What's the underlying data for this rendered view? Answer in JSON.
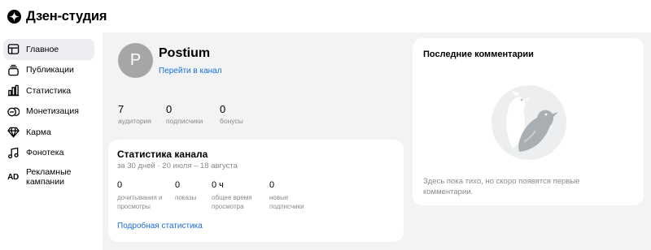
{
  "app": {
    "title": "Дзен-студия",
    "logo_icon": "zen-star-icon"
  },
  "sidebar": {
    "items": [
      {
        "label": "Главное",
        "icon": "layout-icon",
        "active": true
      },
      {
        "label": "Публикации",
        "icon": "publications-icon",
        "active": false
      },
      {
        "label": "Статистика",
        "icon": "bar-chart-icon",
        "active": false
      },
      {
        "label": "Монетизация",
        "icon": "coins-icon",
        "active": false
      },
      {
        "label": "Карма",
        "icon": "diamond-icon",
        "active": false
      },
      {
        "label": "Фонотека",
        "icon": "music-note-icon",
        "active": false
      },
      {
        "label": "Рекламные кампании",
        "icon": "ad-icon",
        "glyph": "AD",
        "active": false
      }
    ]
  },
  "channel": {
    "avatar_letter": "P",
    "name": "Postium",
    "link": "Перейти в канал",
    "stats": [
      {
        "value": "7",
        "caption": "аудитория"
      },
      {
        "value": "0",
        "caption": "подписчики"
      },
      {
        "value": "0",
        "caption": "бонусы"
      }
    ]
  },
  "channel_stats": {
    "title": "Статистика канала",
    "period": "за 30 дней · 20 июля – 18 августа",
    "metrics": [
      {
        "value": "0",
        "caption": "дочитывания и просмотры"
      },
      {
        "value": "0",
        "caption": "показы"
      },
      {
        "value": "0 ч",
        "caption": "общее время просмотра"
      },
      {
        "value": "0",
        "caption": "новые подписчики"
      }
    ],
    "link": "Подробная статистика"
  },
  "comments": {
    "title": "Последние комментарии",
    "empty_text": "Здесь пока тихо, но скоро появятся первые комментарии."
  },
  "colors": {
    "accent": "#1a6fe0",
    "background": "#f2f3f5",
    "active_nav": "#eceef1",
    "muted": "#8a8a8a"
  }
}
